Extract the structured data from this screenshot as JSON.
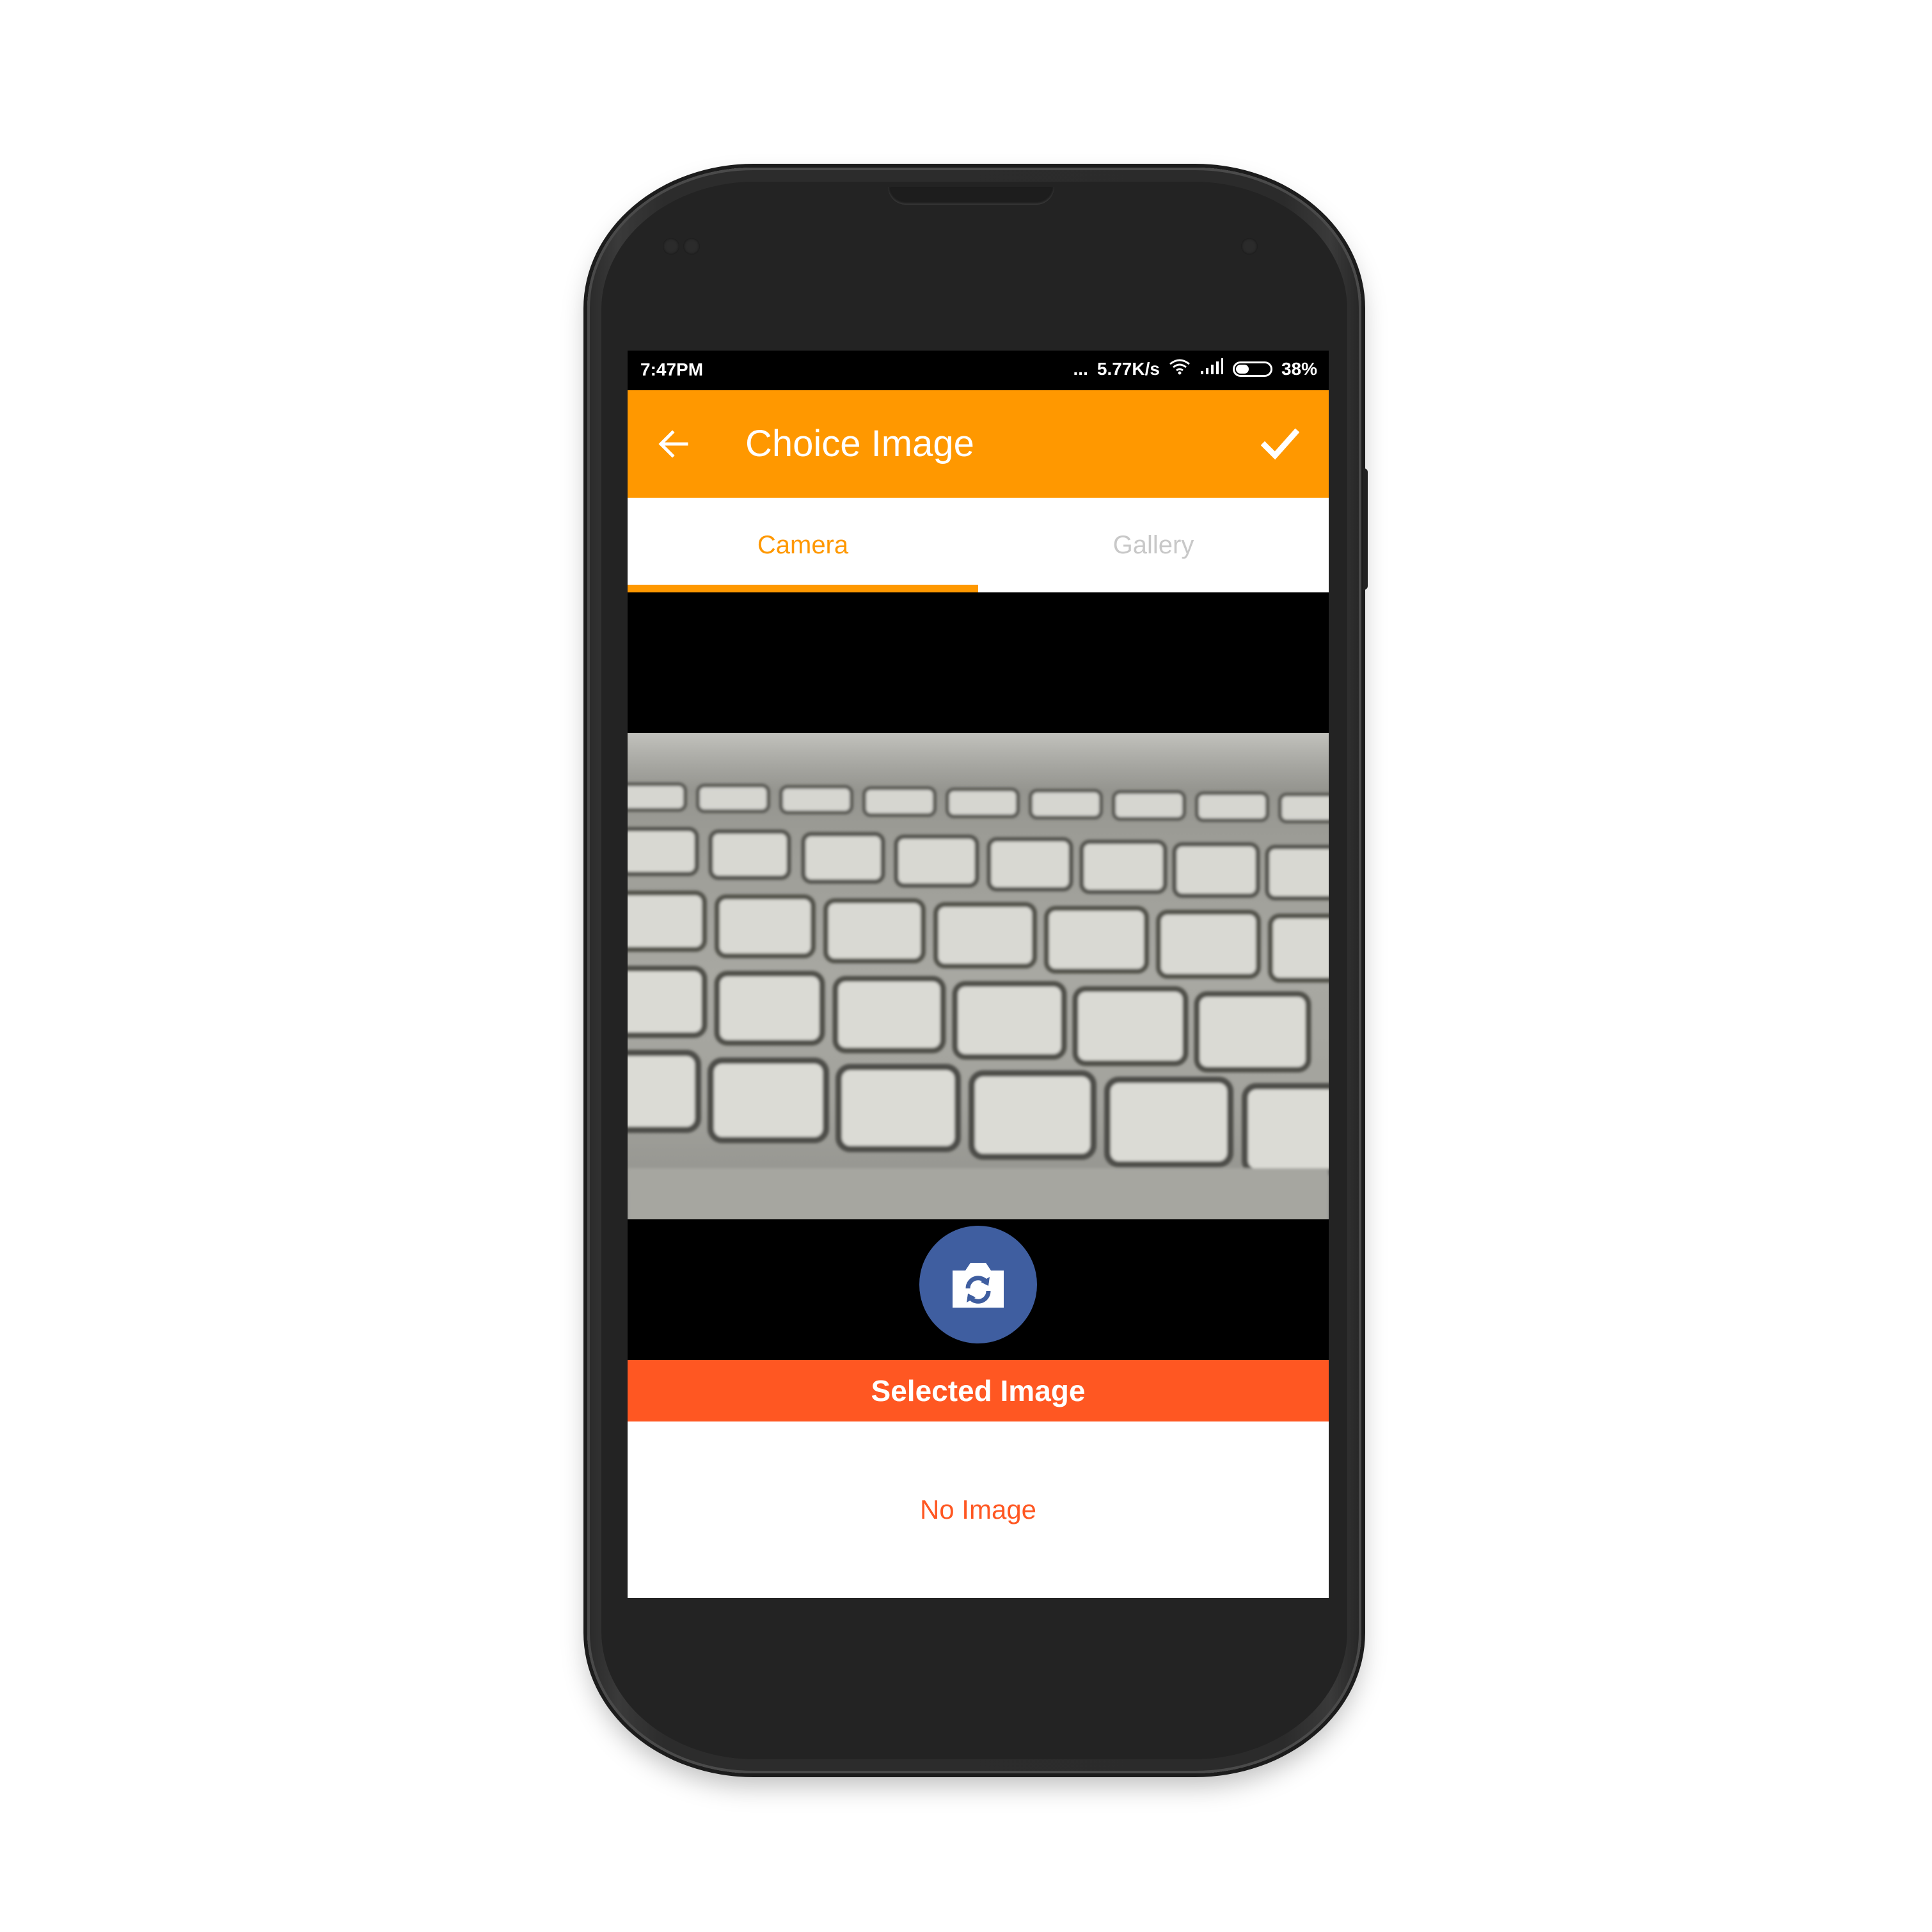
{
  "status_bar": {
    "time": "7:47PM",
    "more": "...",
    "network_speed": "5.77K/s",
    "wifi_icon": "wifi-icon",
    "signal_icon": "signal-icon",
    "battery_icon": "battery-icon",
    "battery_level": 0.38,
    "battery_text": "38%"
  },
  "app_bar": {
    "title": "Choice Image",
    "back_icon": "arrow-left-icon",
    "confirm_icon": "check-icon"
  },
  "tabs": [
    {
      "label": "Camera",
      "selected": true
    },
    {
      "label": "Gallery",
      "selected": false
    }
  ],
  "camera": {
    "switch_icon": "switch-camera-icon"
  },
  "selected": {
    "header": "Selected Image",
    "empty_text": "No Image"
  },
  "colors": {
    "primary": "#ff9800",
    "accent": "#ff5722",
    "switch_button": "#3f5ea0",
    "tab_inactive": "#c8c8c8"
  }
}
